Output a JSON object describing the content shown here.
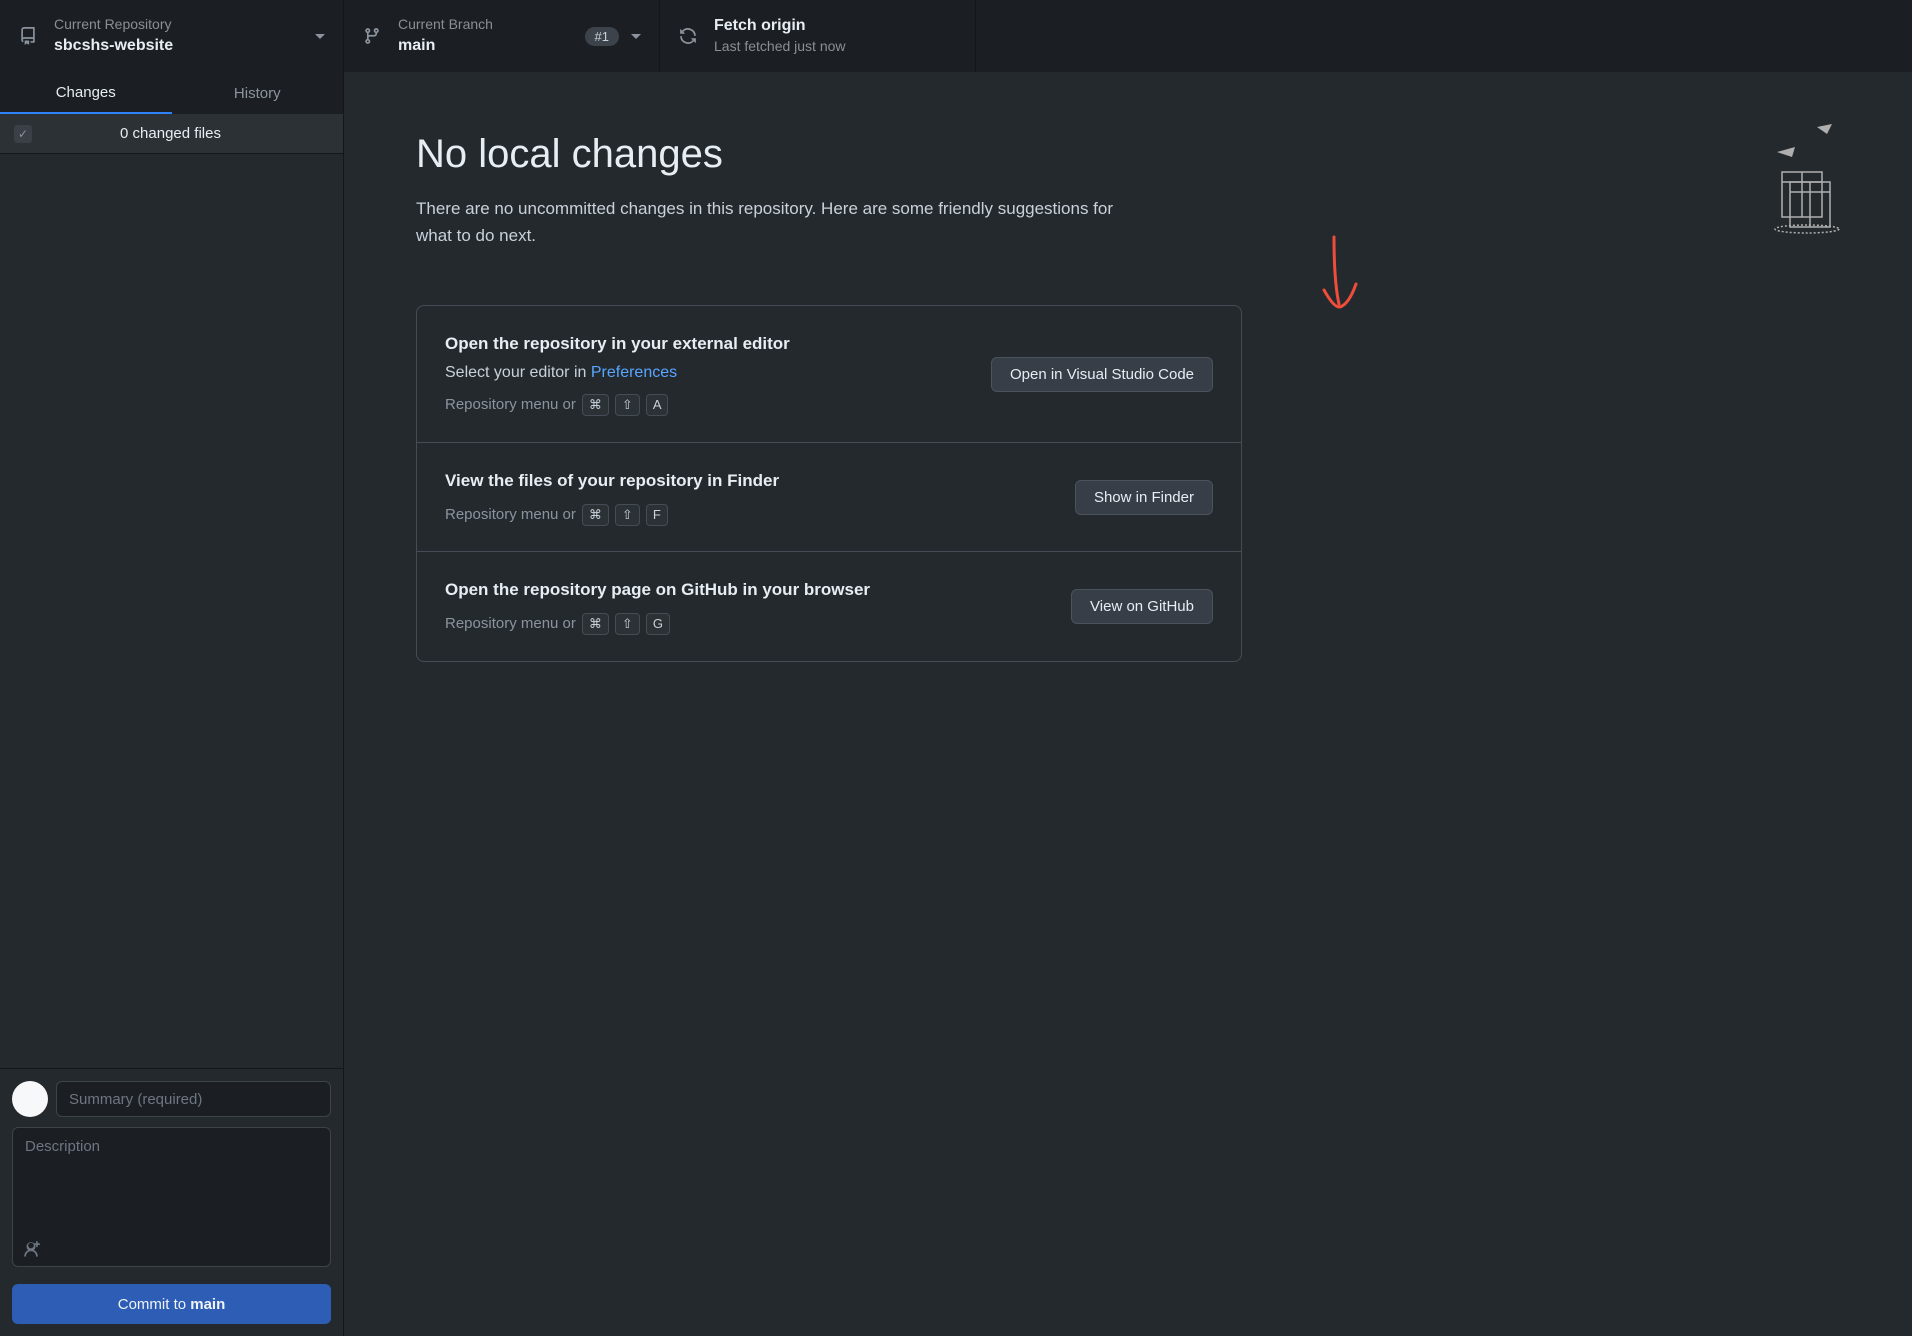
{
  "toolbar": {
    "repo": {
      "label": "Current Repository",
      "value": "sbcshs-website"
    },
    "branch": {
      "label": "Current Branch",
      "value": "main",
      "pill": "#1"
    },
    "fetch": {
      "title": "Fetch origin",
      "sub": "Last fetched just now"
    }
  },
  "sidebar": {
    "tabs": {
      "changes": "Changes",
      "history": "History"
    },
    "changes_count": "0 changed files",
    "summary_placeholder": "Summary (required)",
    "description_placeholder": "Description",
    "commit_prefix": "Commit to ",
    "commit_branch": "main"
  },
  "content": {
    "heading": "No local changes",
    "subheading": "There are no uncommitted changes in this repository. Here are some friendly suggestions for what to do next.",
    "suggestions": [
      {
        "title": "Open the repository in your external editor",
        "detail_prefix": "Select your editor in ",
        "detail_link": "Preferences",
        "hint_prefix": "Repository menu or",
        "keys": [
          "⌘",
          "⇧",
          "A"
        ],
        "button": "Open in Visual Studio Code"
      },
      {
        "title": "View the files of your repository in Finder",
        "hint_prefix": "Repository menu or",
        "keys": [
          "⌘",
          "⇧",
          "F"
        ],
        "button": "Show in Finder"
      },
      {
        "title": "Open the repository page on GitHub in your browser",
        "hint_prefix": "Repository menu or",
        "keys": [
          "⌘",
          "⇧",
          "G"
        ],
        "button": "View on GitHub"
      }
    ]
  }
}
